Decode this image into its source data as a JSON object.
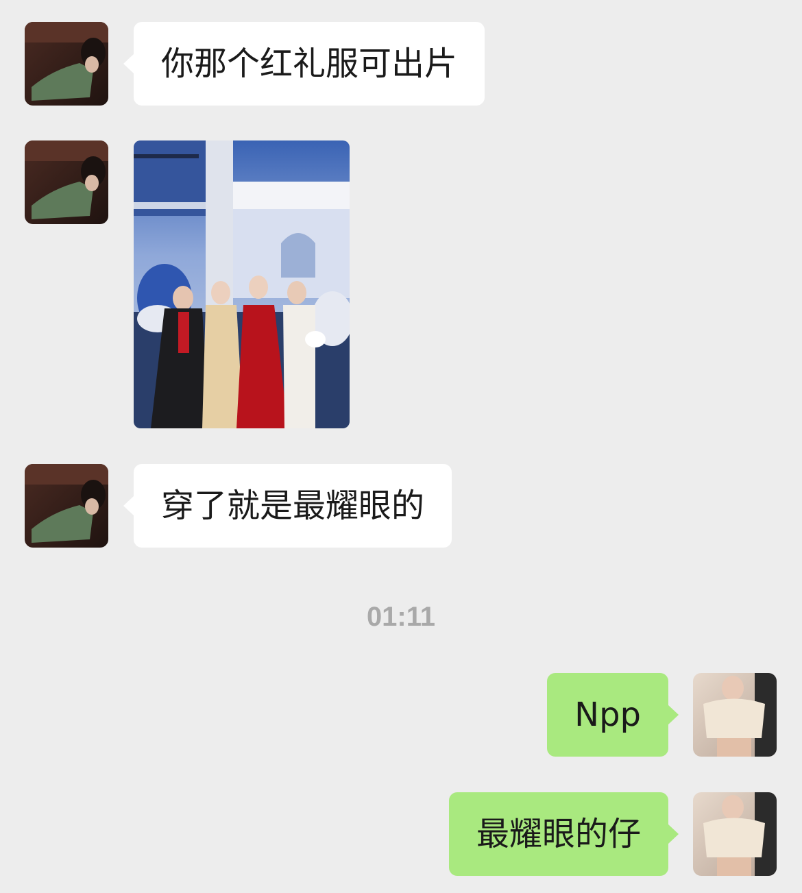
{
  "conversation": {
    "timestamp": "01:11",
    "messages": [
      {
        "sender": "other",
        "type": "text",
        "text": "你那个红礼服可出片"
      },
      {
        "sender": "other",
        "type": "image",
        "image_name": "group-photo"
      },
      {
        "sender": "other",
        "type": "text",
        "text": "穿了就是最耀眼的"
      },
      {
        "sender": "me",
        "type": "text",
        "text": "Npp"
      },
      {
        "sender": "me",
        "type": "text",
        "text": "最耀眼的仔"
      }
    ]
  },
  "colors": {
    "background": "#ededed",
    "incoming_bubble": "#ffffff",
    "outgoing_bubble": "#a9e97f",
    "timestamp_text": "#a9a9a9"
  }
}
